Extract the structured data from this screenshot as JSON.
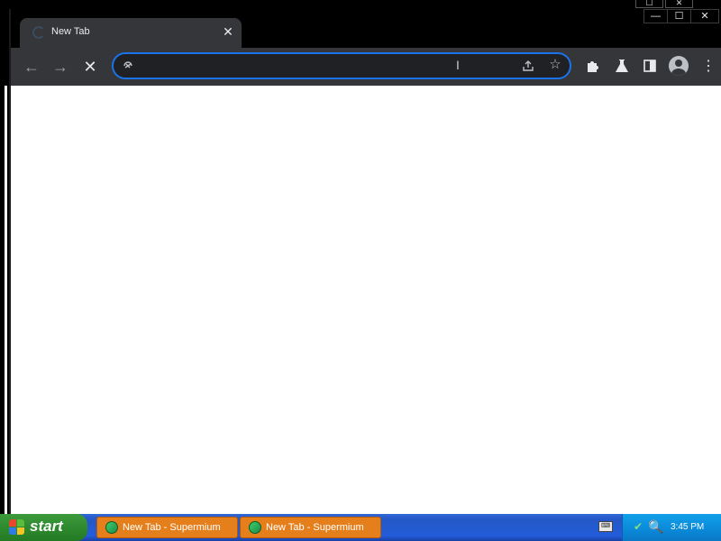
{
  "browser": {
    "tab": {
      "title": "New Tab"
    },
    "window_controls": {
      "minimize": "—",
      "maximize": "☐",
      "close": "✕"
    },
    "background_window_controls": {
      "maximize": "☐",
      "close": "✕"
    },
    "toolbar": {
      "back_icon": "←",
      "forward_icon": "→",
      "stop_icon": "✕",
      "omnibox": {
        "value": "",
        "placeholder": ""
      },
      "share_icon": "⇪",
      "star_icon": "☆",
      "extensions_icon": "✚",
      "labs_icon": "⚗",
      "side_panel_icon": "◧",
      "menu_icon": "⋮"
    }
  },
  "taskbar": {
    "start_label": "start",
    "tasks": [
      {
        "label": "New Tab - Supermium"
      },
      {
        "label": "New Tab - Supermium"
      }
    ],
    "clock": "3:45 PM"
  }
}
